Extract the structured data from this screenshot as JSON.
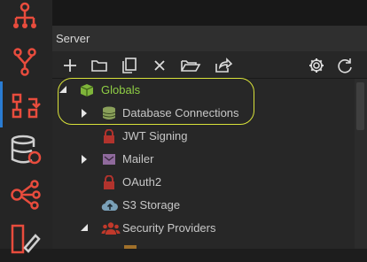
{
  "panel": {
    "title": "Server"
  },
  "toolbar": {
    "buttons": [
      "plus-icon",
      "folder-icon",
      "copy-icon",
      "close-icon",
      "folder-open-icon",
      "share-icon",
      "gear-icon",
      "refresh-icon"
    ]
  },
  "tree": {
    "items": [
      {
        "label": "Globals",
        "icon": "cube-icon",
        "expanded": true
      },
      {
        "label": "Database Connections",
        "icon": "database-icon",
        "expanded": false
      },
      {
        "label": "JWT Signing",
        "icon": "lock-icon"
      },
      {
        "label": "Mailer",
        "icon": "mail-icon",
        "expanded": false
      },
      {
        "label": "OAuth2",
        "icon": "lock-icon"
      },
      {
        "label": "S3 Storage",
        "icon": "cloud-upload-icon"
      },
      {
        "label": "Security Providers",
        "icon": "users-icon",
        "expanded": true
      }
    ]
  },
  "colors": {
    "accent_red": "#e84c3d",
    "globals_green": "#8fce45",
    "highlight_yellow": "#d8e23a",
    "db_green": "#8aa05a",
    "lock_red": "#b2332d",
    "mail_purple": "#8f6a9c",
    "cloud_blue": "#7aa0b8"
  }
}
